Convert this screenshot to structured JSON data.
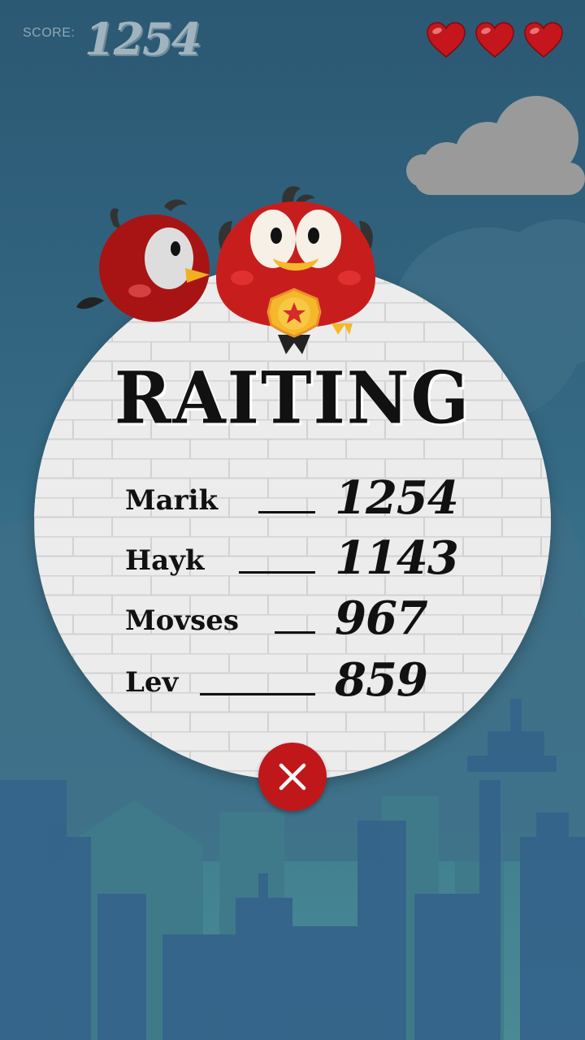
{
  "hud": {
    "score_label": "SCORE:",
    "score_value": "1254",
    "lives": 3,
    "heart_color": "#c4161c"
  },
  "popup": {
    "title": "RAITING",
    "rows": [
      {
        "name": "Marik",
        "score": "1254"
      },
      {
        "name": "Hayk",
        "score": "1143"
      },
      {
        "name": "Movses",
        "score": "967"
      },
      {
        "name": "Lev",
        "score": "859"
      }
    ]
  },
  "colors": {
    "sky_top": "#2b5873",
    "bird_red": "#c81d1d",
    "close_button": "#c0171b",
    "medal_gold": "#f5b82a"
  },
  "icons": {
    "close": "close-icon",
    "life": "heart-icon",
    "medal": "medal-icon"
  }
}
